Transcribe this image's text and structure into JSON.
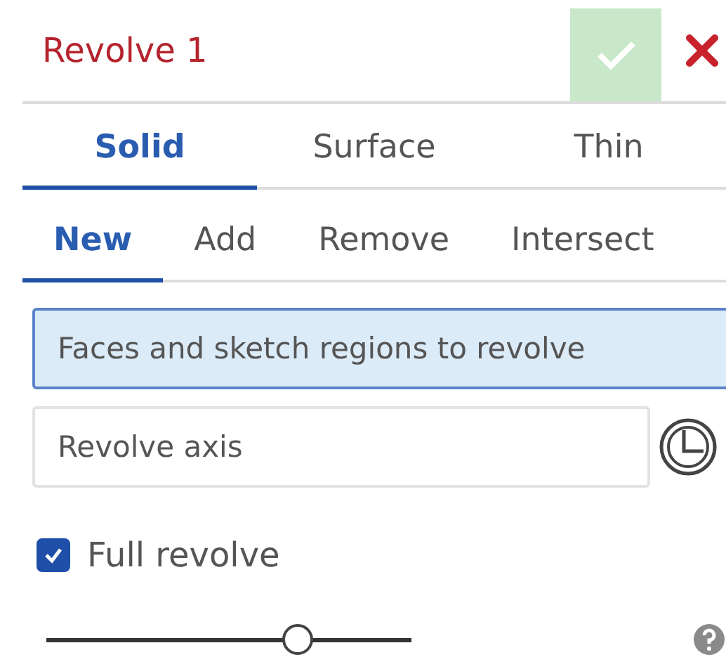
{
  "title": "Revolve 1",
  "body_types": [
    {
      "label": "Solid",
      "selected": true
    },
    {
      "label": "Surface",
      "selected": false
    },
    {
      "label": "Thin",
      "selected": false
    }
  ],
  "operations": [
    {
      "label": "New",
      "selected": true
    },
    {
      "label": "Add",
      "selected": false
    },
    {
      "label": "Remove",
      "selected": false
    },
    {
      "label": "Intersect",
      "selected": false
    }
  ],
  "fields": [
    {
      "placeholder": "Faces and sketch regions to revolve",
      "active": true,
      "kind": "plain"
    },
    {
      "placeholder": "Revolve axis",
      "active": false,
      "kind": "axis"
    }
  ],
  "full_revolve": {
    "label": "Full revolve",
    "checked": true
  },
  "slider": {
    "level": 0.69
  }
}
